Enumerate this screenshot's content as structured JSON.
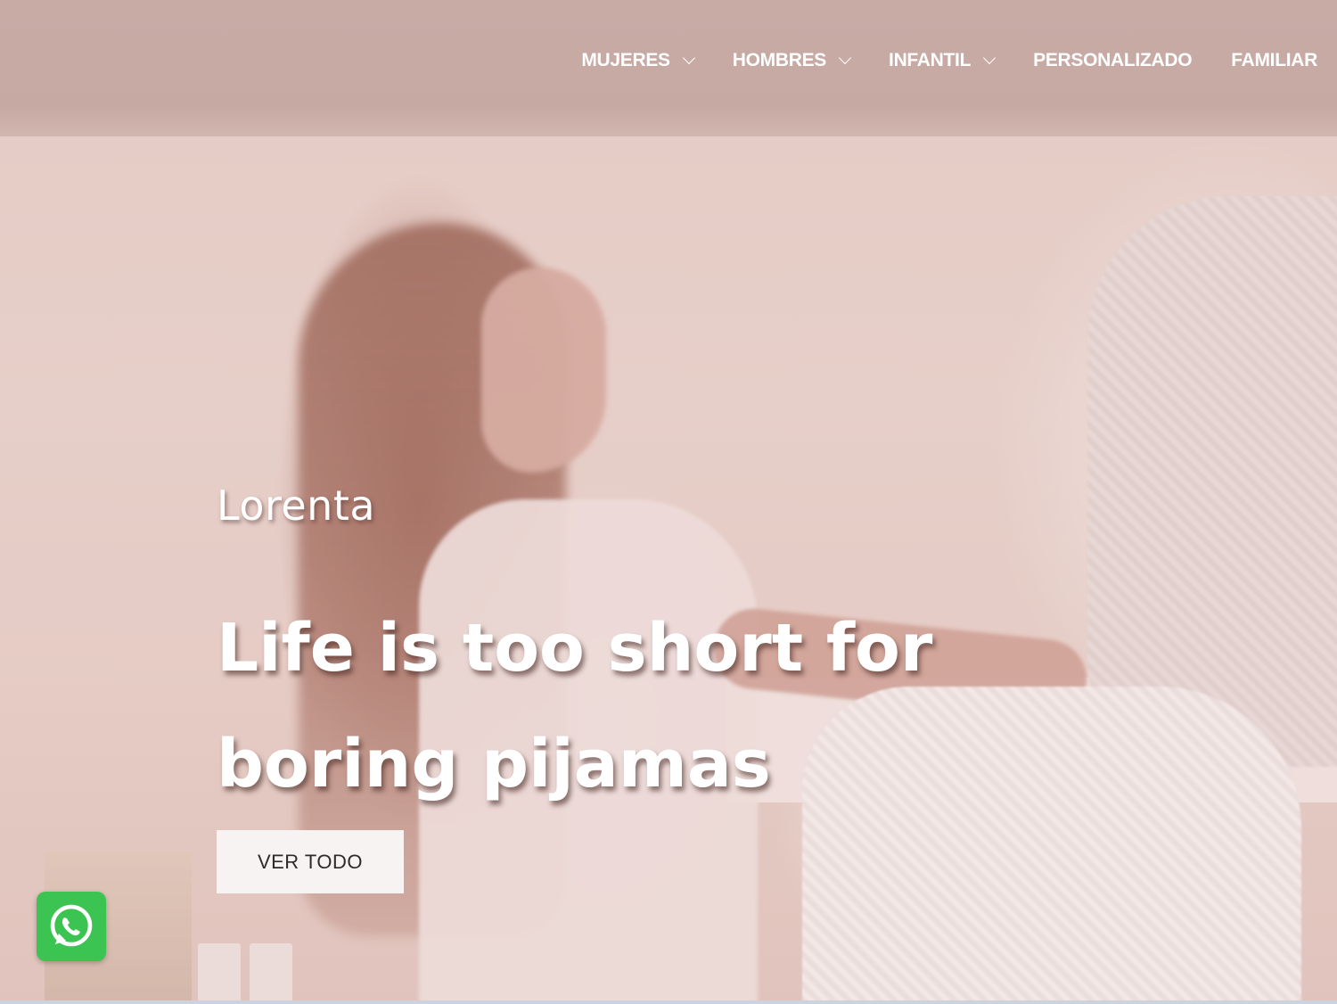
{
  "header": {
    "nav": [
      {
        "label": "MUJERES",
        "has_dropdown": true
      },
      {
        "label": "HOMBRES",
        "has_dropdown": true
      },
      {
        "label": "INFANTIL",
        "has_dropdown": true
      },
      {
        "label": "PERSONALIZADO",
        "has_dropdown": false
      },
      {
        "label": "FAMILIAR",
        "has_dropdown": false
      }
    ]
  },
  "hero": {
    "eyebrow": "Lorenta",
    "headline_line1": "Life is too short for",
    "headline_line2": "boring pijamas",
    "cta_label": "VER TODO"
  },
  "floating": {
    "whatsapp_icon": "whatsapp-icon"
  },
  "colors": {
    "header_bg": "#c9aba6",
    "whatsapp_green": "#3cc453",
    "cta_bg": "#f7f3f2",
    "text_white": "#ffffff"
  }
}
